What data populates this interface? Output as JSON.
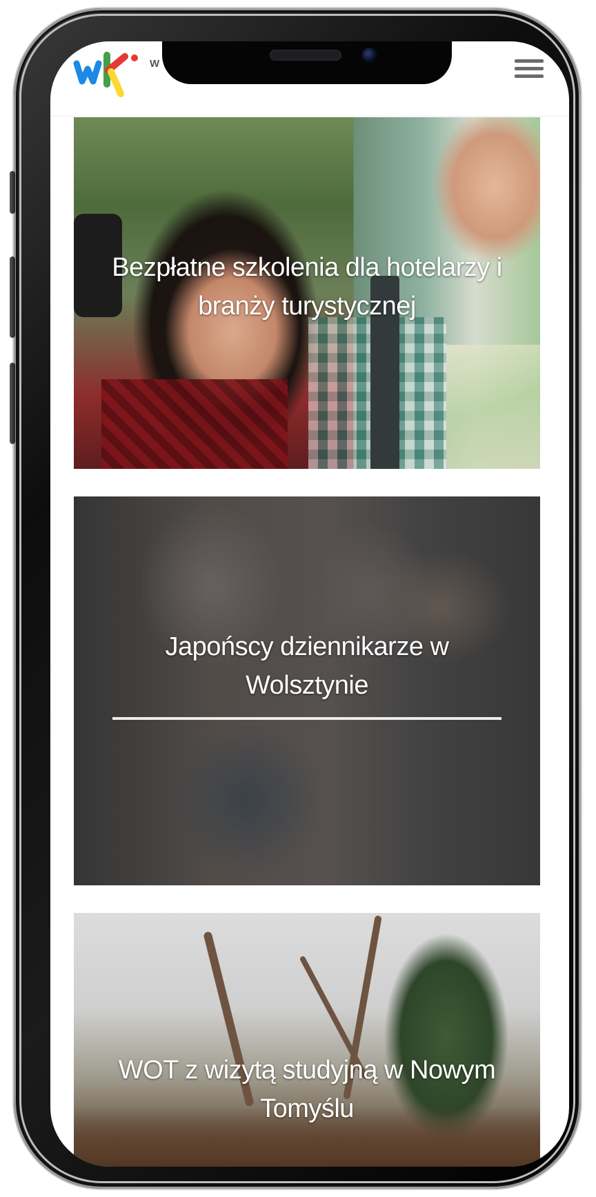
{
  "header": {
    "logo_alt": "wk",
    "logo_text": "W",
    "menu_icon": "hamburger-menu-icon"
  },
  "articles": [
    {
      "title": "Bezpłatne szkolenia dla hotelarzy i branży turystycznej"
    },
    {
      "title": "Japońscy dziennikarze w Wolsztynie"
    },
    {
      "title": "WOT z wizytą studyjną w Nowym Tomyślu"
    }
  ],
  "colors": {
    "logo_blue": "#1e88e5",
    "logo_green": "#43a047",
    "logo_red": "#e53935",
    "logo_yellow": "#fdd835",
    "menu_icon": "#6b6b6b"
  }
}
